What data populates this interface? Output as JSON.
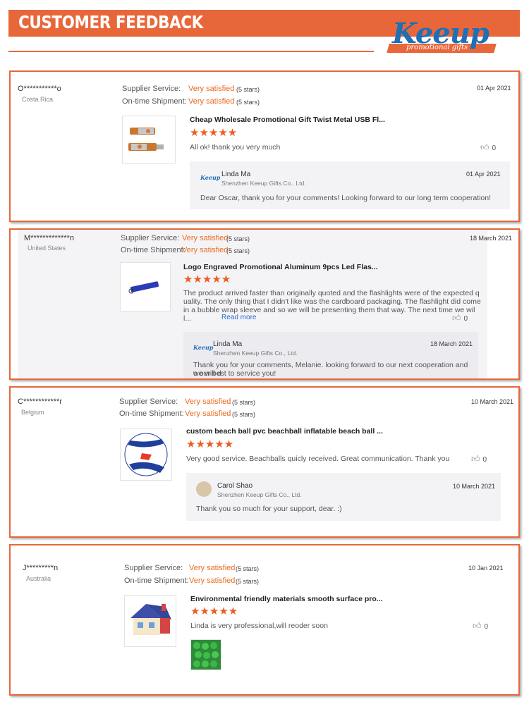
{
  "header": {
    "title": "CUSTOMER FEEDBACK",
    "logo_word": "Keeup",
    "logo_sub": "promotional gifts"
  },
  "labels": {
    "supplier": "Supplier Service:",
    "shipment": "On-time Shipment:",
    "read_more": "Read more"
  },
  "reviews": [
    {
      "user": "O***********o",
      "country": "Costa Rica",
      "supplier_rating": "Very satisfied",
      "supplier_stars": "(5 stars)",
      "shipment_rating": "Very satisfied",
      "shipment_stars": "(5 stars)",
      "date": "01 Apr 2021",
      "product_title": "Cheap Wholesale Promotional Gift Twist Metal USB Fl...",
      "stars": "★★★★★",
      "comment": "All ok! thank you very much",
      "likes": "0",
      "reply": {
        "name": "Linda Ma",
        "company": "Shenzhen Keeup Gifts Co., Ltd.",
        "date": "01 Apr 2021",
        "text": "Dear Oscar, thank you for your comments! Looking forward to our long term cooperation!",
        "logo": "Keeup"
      }
    },
    {
      "user": "M*************n",
      "country": "United States",
      "supplier_rating": "Very satisfied",
      "supplier_stars": "(5 stars)",
      "shipment_rating": "Very satisfied",
      "shipment_stars": "(5 stars)",
      "date": "18 March 2021",
      "product_title": "Logo Engraved Promotional Aluminum 9pcs Led Flas...",
      "stars": "★★★★★",
      "comment_lines": [
        "The product arrived faster than originally quoted and the flashlights were of the expected q",
        "uality. The only thing that I didn't like was the cardboard packaging. The flashlight did come",
        "in a bubble wrap sleeve and so we will be presenting them that way. The next time we wil",
        "l..."
      ],
      "likes": "0",
      "reply": {
        "name": "Linda Ma",
        "company": "Shenzhen Keeup Gifts Co., Ltd.",
        "date": "18 March 2021",
        "text_lines": [
          "Thank you for your comments, Melanie. looking forward to our next cooperation and we will d",
          "o our best to service you!"
        ],
        "logo": "Keeup"
      }
    },
    {
      "user": "C************r",
      "country": "Belgium",
      "supplier_rating": "Very satisfied",
      "supplier_stars": "(5 stars)",
      "shipment_rating": "Very satisfied",
      "shipment_stars": "(5 stars)",
      "date": "10 March 2021",
      "product_title": "custom beach ball pvc beachball inflatable beach ball ...",
      "stars": "★★★★★",
      "comment": "Very good service.  Beachballs quicly received. Great communication.  Thank you",
      "likes": "0",
      "reply": {
        "name": "Carol Shao",
        "company": "Shenzhen Keeup Gifts Co., Ltd.",
        "date": "10 March 2021",
        "text": "Thank you so much for your support, dear. :)"
      }
    },
    {
      "user": "J*********n",
      "country": "Australia",
      "supplier_rating": "Very satisfied",
      "supplier_stars": "(5 stars)",
      "shipment_rating": "Very satisfied",
      "shipment_stars": "(5 stars)",
      "date": "10 Jan 2021",
      "product_title": "Environmental friendly materials smooth surface pro...",
      "stars": "★★★★★",
      "comment": "Linda is very professional,will reoder soon",
      "likes": "0"
    }
  ],
  "colors": {
    "accent": "#e8673a",
    "rating": "#ec6a1f",
    "brand_blue": "#1d6fb8",
    "link": "#2a6dd0"
  },
  "icons": {
    "like": "thumbs-up-icon",
    "star": "star-icon"
  }
}
